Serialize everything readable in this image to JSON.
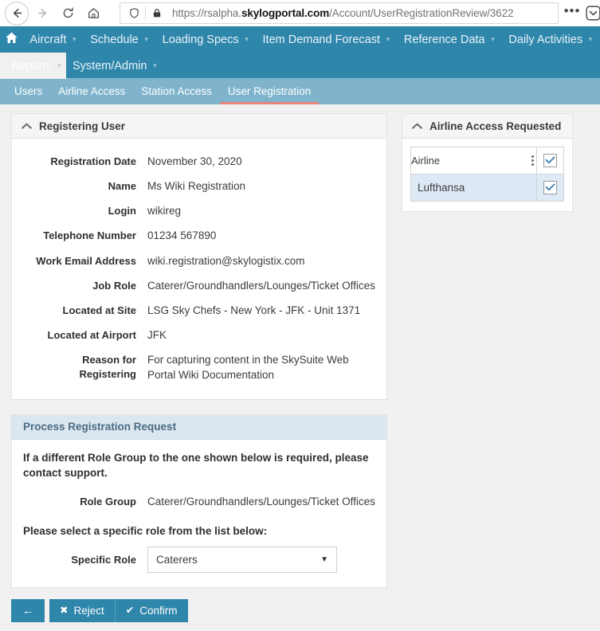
{
  "browser": {
    "back_icon": "arrow-left-icon",
    "forward_icon": "arrow-right-icon",
    "reload_icon": "reload-icon",
    "home_icon": "home-icon",
    "shield_icon": "shield-icon",
    "lock_icon": "lock-icon",
    "url_prefix": "https://rsalpha.",
    "url_domain": "skylogportal.com",
    "url_path": "/Account/UserRegistrationReview/3622",
    "menu_label": "•••",
    "chevron_icon": "chevron-down-circle-icon"
  },
  "appnav": {
    "home_icon": "home-icon",
    "row1": [
      {
        "label": "Aircraft",
        "caret": "▼"
      },
      {
        "label": "Schedule",
        "caret": "▼"
      },
      {
        "label": "Loading Specs",
        "caret": "▼"
      },
      {
        "label": "Item Demand Forecast",
        "caret": "▼"
      },
      {
        "label": "Reference Data",
        "caret": "▼"
      },
      {
        "label": "Daily Activities",
        "caret": "▼"
      }
    ],
    "row2": [
      {
        "label": "Reports",
        "caret": "▼"
      },
      {
        "label": "System/Admin",
        "caret": "▼"
      }
    ]
  },
  "tabs": [
    {
      "label": "Users"
    },
    {
      "label": "Airline Access"
    },
    {
      "label": "Station Access"
    },
    {
      "label": "User Registration"
    }
  ],
  "registering_user": {
    "panel_title": "Registering User",
    "collapse_icon": "chevron-up-icon",
    "fields": [
      {
        "label": "Registration Date",
        "value": "November 30, 2020"
      },
      {
        "label": "Name",
        "value": "Ms Wiki Registration"
      },
      {
        "label": "Login",
        "value": "wikireg"
      },
      {
        "label": "Telephone Number",
        "value": "01234 567890"
      },
      {
        "label": "Work Email Address",
        "value": "wiki.registration@skylogistix.com"
      },
      {
        "label": "Job Role",
        "value": "Caterer/Groundhandlers/Lounges/Ticket Offices"
      },
      {
        "label": "Located at Site",
        "value": "LSG Sky Chefs - New York - JFK - Unit 1371"
      },
      {
        "label": "Located at Airport",
        "value": "JFK"
      },
      {
        "label": "Reason for Registering",
        "value": "For capturing content in the SkySuite Web Portal Wiki Documentation"
      }
    ]
  },
  "airline_access": {
    "panel_title": "Airline Access Requested",
    "collapse_icon": "chevron-up-icon",
    "column_header": "Airline",
    "kebab_icon": "kebab-menu-icon",
    "header_checkbox_checked": true,
    "rows": [
      {
        "name": "Lufthansa",
        "checked": true
      }
    ]
  },
  "process_request": {
    "panel_title": "Process Registration Request",
    "note": "If a different Role Group to the one shown below is required, please contact support.",
    "role_group_label": "Role Group",
    "role_group_value": "Caterer/Groundhandlers/Lounges/Ticket Offices",
    "select_prompt": "Please select a specific role from the list below:",
    "specific_role_label": "Specific Role",
    "specific_role_value": "Caterers",
    "dropdown_arrow": "▼"
  },
  "footer": {
    "back_label": "←",
    "reject_label": "Reject",
    "reject_icon": "✖",
    "confirm_label": "Confirm",
    "confirm_icon": "✔"
  },
  "colors": {
    "nav_teal": "#2f86ab",
    "tab_strip": "#7fb4cc",
    "active_tab_underline": "#e8837c",
    "process_header": "#dbe7f0",
    "row_highlight": "#ddeaf6",
    "page_bg": "#f2f1f1"
  }
}
